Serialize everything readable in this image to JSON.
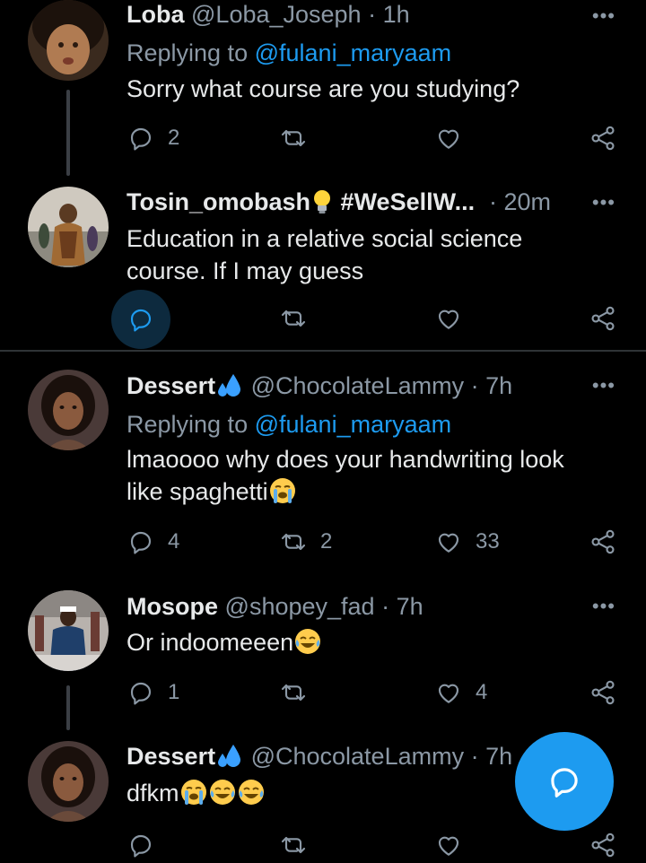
{
  "colors": {
    "accent": "#1d9bf0",
    "muted": "#8b98a5",
    "text": "#e7e9ea",
    "background": "#000000"
  },
  "tweets": [
    {
      "name": "Loba",
      "handle": "@Loba_Joseph",
      "time": "1h",
      "reply_label": "Replying to",
      "reply_mention": "@fulani_maryaam",
      "text": "Sorry what course are you studying?",
      "replies": "2",
      "retweets": "",
      "likes": ""
    },
    {
      "name": "Tosin_omobash",
      "name_emoji": "light-bulb-icon",
      "name_tag": "#WeSellW...",
      "time": "20m",
      "text": "Education in a relative social science course. If I may guess",
      "replies": "",
      "retweets": "",
      "likes": ""
    },
    {
      "name": "Dessert",
      "name_emoji": "sweat-droplets-icon",
      "handle": "@ChocolateLammy",
      "time": "7h",
      "reply_label": "Replying to",
      "reply_mention": "@fulani_maryaam",
      "text": "lmaoooo why does your handwriting look like spaghetti",
      "text_emoji": "loudly-crying-face-icon",
      "replies": "4",
      "retweets": "2",
      "likes": "33"
    },
    {
      "name": "Mosope",
      "handle": "@shopey_fad",
      "time": "7h",
      "text": "Or indoomeeen",
      "text_emoji": "tears-of-joy-face-icon",
      "replies": "1",
      "retweets": "",
      "likes": "4"
    },
    {
      "name": "Dessert",
      "name_emoji": "sweat-droplets-icon",
      "handle": "@ChocolateLammy",
      "time": "7h",
      "text": "dfkm",
      "text_emojis": [
        "loudly-crying-face-icon",
        "tears-of-joy-face-icon",
        "tears-of-joy-face-icon"
      ],
      "replies": "",
      "retweets": "",
      "likes": ""
    }
  ],
  "fab": {
    "icon": "compose-reply-icon"
  },
  "more_glyph": "•••"
}
